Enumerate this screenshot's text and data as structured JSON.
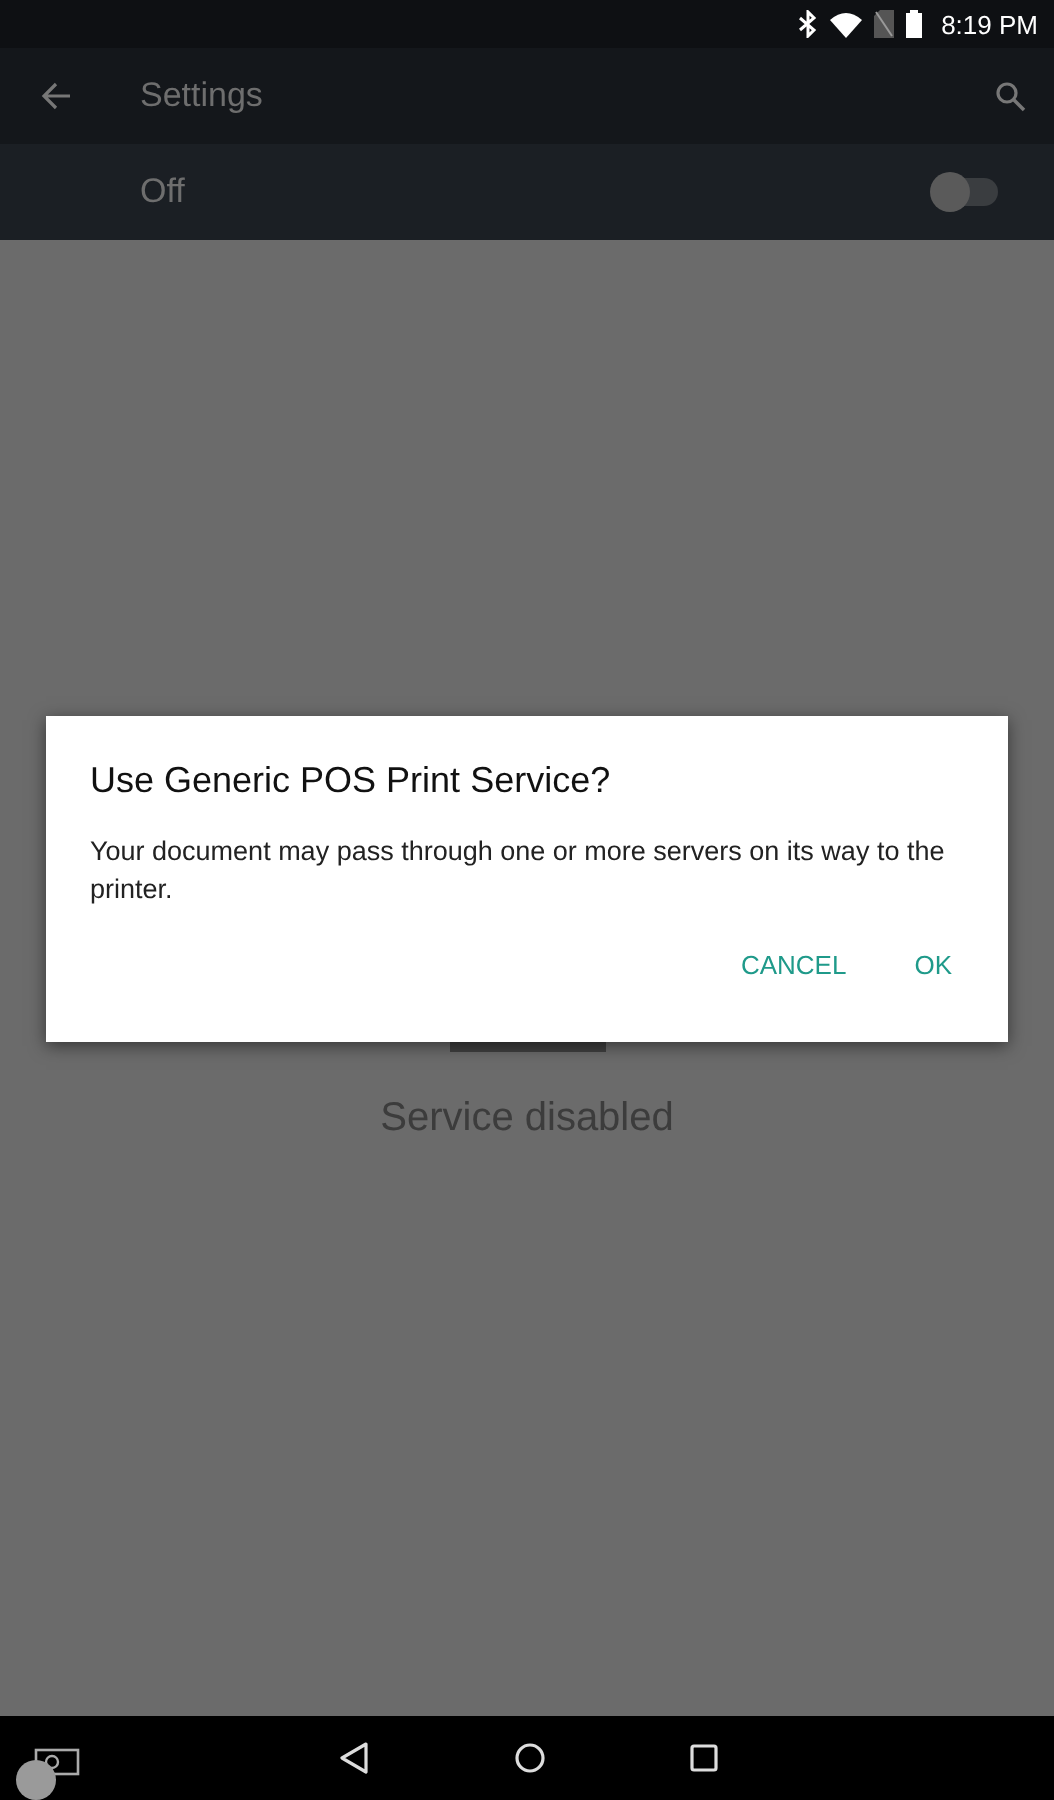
{
  "status_bar": {
    "time": "8:19 PM"
  },
  "toolbar": {
    "title": "Settings"
  },
  "master_switch": {
    "label": "Off",
    "on": false
  },
  "empty_state": {
    "text": "Service disabled"
  },
  "dialog": {
    "title": "Use Generic POS Print Service?",
    "message": "Your document may pass through one or more servers on its way to the printer.",
    "buttons": [
      "CANCEL",
      "OK"
    ]
  }
}
